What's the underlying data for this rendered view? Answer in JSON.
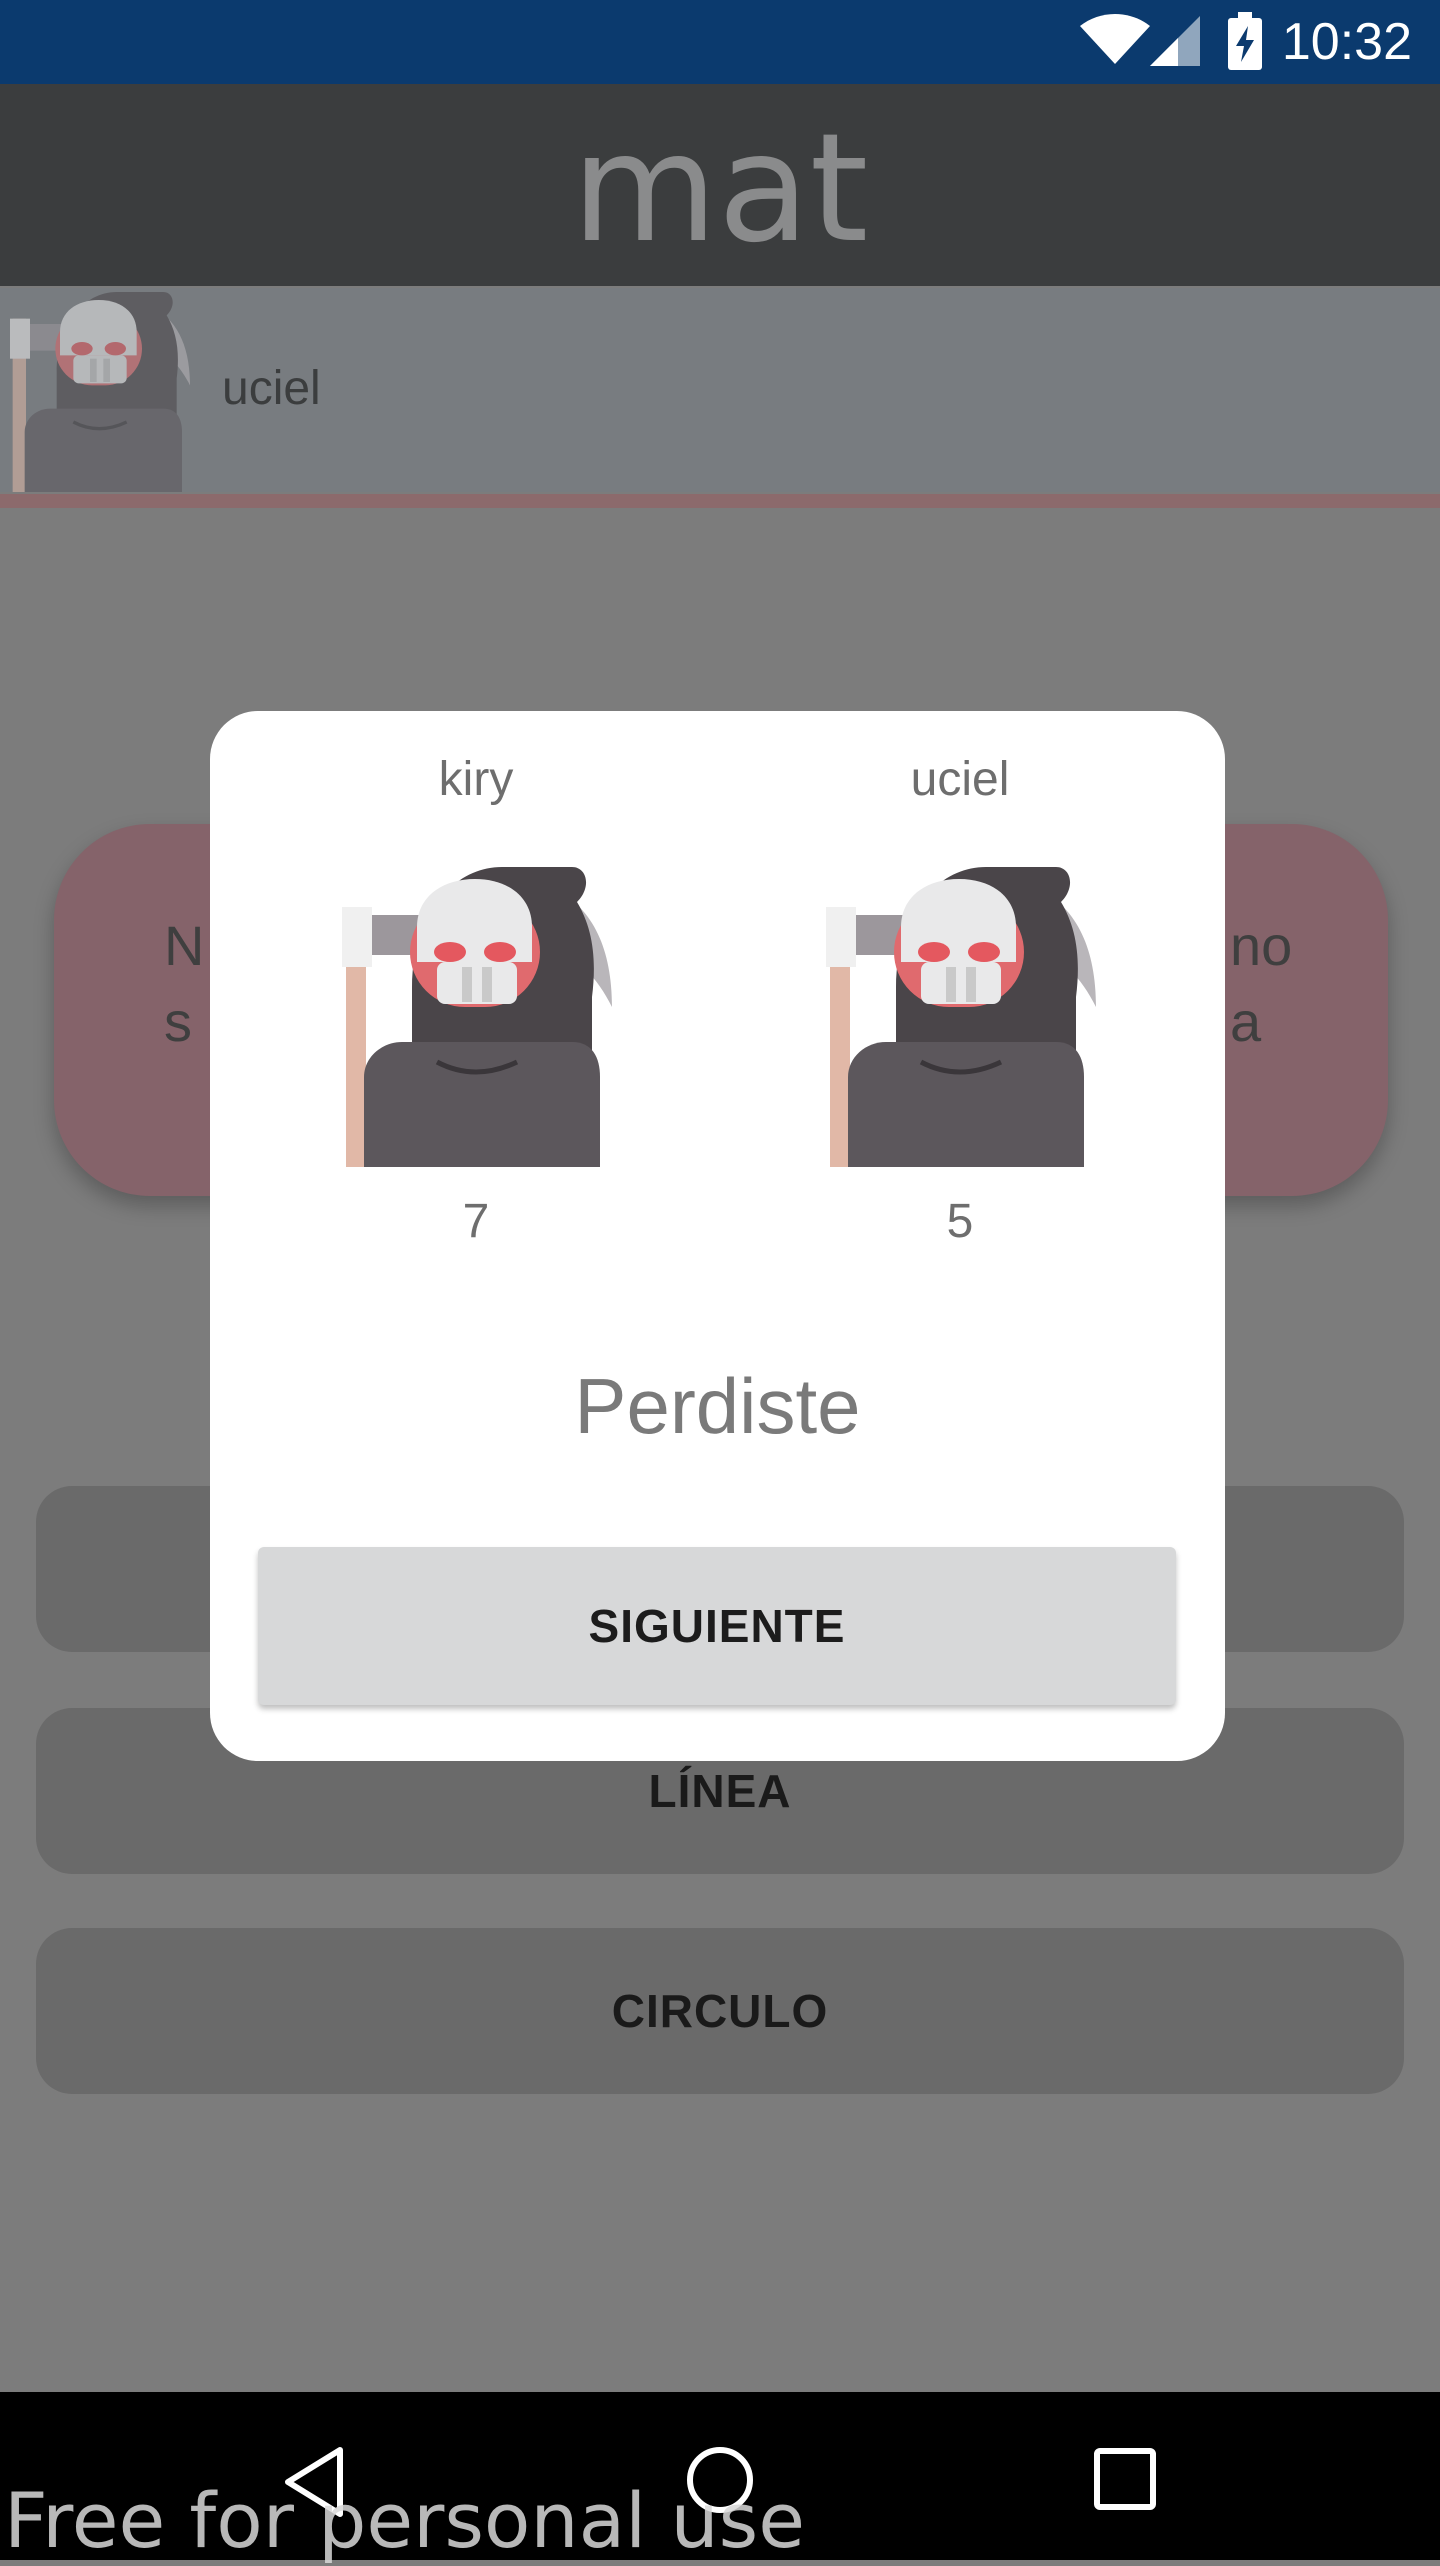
{
  "status_bar": {
    "time": "10:32",
    "icons": [
      "wifi-icon",
      "signal-icon",
      "battery-charging-icon"
    ],
    "background_color": "#0b3a6e"
  },
  "app_bar": {
    "title": "mat",
    "background_color": "#3b3d3e"
  },
  "current_player": {
    "name": "uciel",
    "avatar": "grim-reaper-avatar"
  },
  "background": {
    "card_left_text": "N\ns",
    "card_right_text": "no\na",
    "buttons": [
      {
        "label": ""
      },
      {
        "label": "LÍNEA"
      },
      {
        "label": "CIRCULO"
      }
    ]
  },
  "dialog": {
    "players": [
      {
        "name": "kiry",
        "score": "7",
        "avatar": "grim-reaper-avatar"
      },
      {
        "name": "uciel",
        "score": "5",
        "avatar": "grim-reaper-avatar"
      }
    ],
    "result": "Perdiste",
    "next_button": "SIGUIENTE"
  },
  "nav_bar": {
    "icons": [
      "back-icon",
      "home-icon",
      "recents-icon"
    ]
  },
  "watermark": "Free for personal use"
}
